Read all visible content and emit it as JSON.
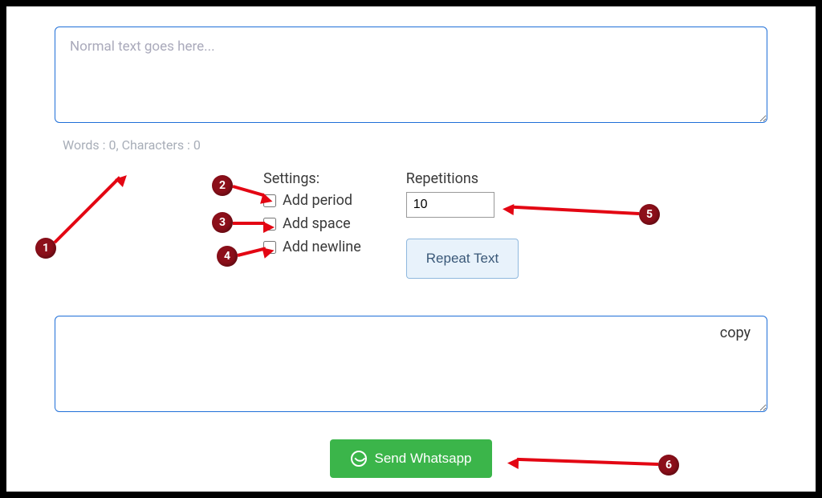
{
  "input": {
    "placeholder": "Normal text goes here...",
    "value": ""
  },
  "counts": {
    "words_label": "Words : 0",
    "chars_label": "Characters : 0"
  },
  "settings": {
    "title": "Settings:",
    "add_period": "Add period",
    "add_space": "Add space",
    "add_newline": "Add newline"
  },
  "repetitions": {
    "label": "Repetitions",
    "value": "10"
  },
  "buttons": {
    "repeat": "Repeat Text",
    "copy": "copy",
    "send": "Send Whatsapp"
  },
  "annotations": {
    "n1": "1",
    "n2": "2",
    "n3": "3",
    "n4": "4",
    "n5": "5",
    "n6": "6"
  }
}
